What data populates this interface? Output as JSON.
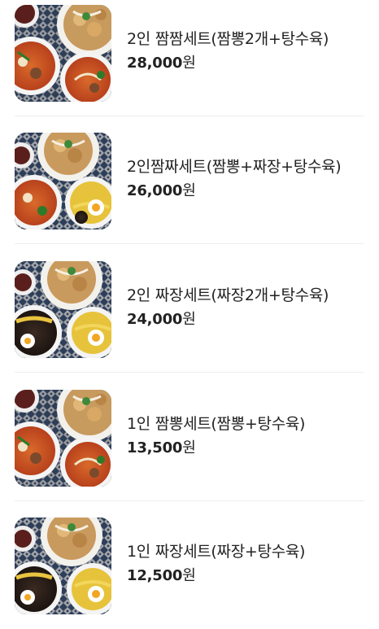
{
  "menu": {
    "items": [
      {
        "name": "2인 짬짬세트(짬뽕2개+탕수육)",
        "price": "28,000",
        "currency": "원",
        "image": "food-photo-jjamppong-set"
      },
      {
        "name": "2인짬짜세트(짬뽕+짜장+탕수육)",
        "price": "26,000",
        "currency": "원",
        "image": "food-photo-mixed-set"
      },
      {
        "name": "2인 짜장세트(짜장2개+탕수육)",
        "price": "24,000",
        "currency": "원",
        "image": "food-photo-jjajang-set"
      },
      {
        "name": "1인 짬뽕세트(짬뽕+탕수육)",
        "price": "13,500",
        "currency": "원",
        "image": "food-photo-jjamppong-set"
      },
      {
        "name": "1인 짜장세트(짜장+탕수육)",
        "price": "12,500",
        "currency": "원",
        "image": "food-photo-jjajang-set"
      }
    ]
  }
}
